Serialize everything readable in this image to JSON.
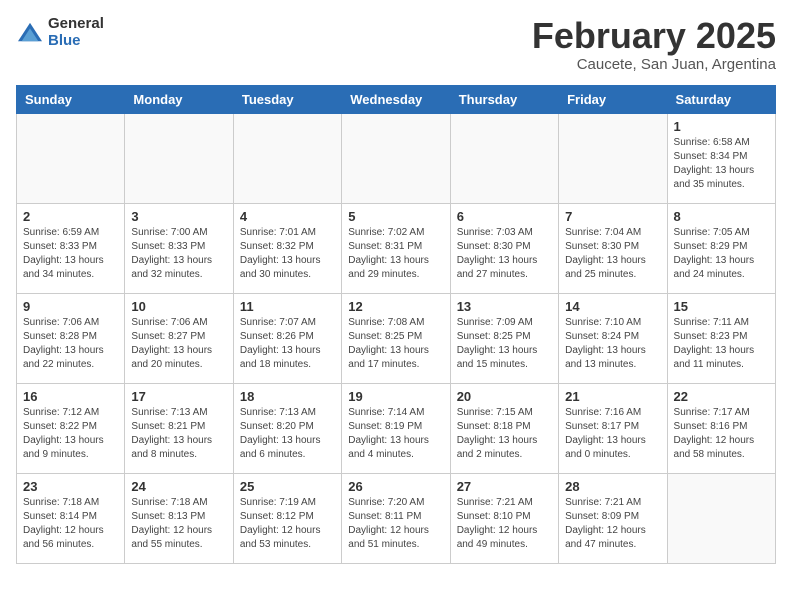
{
  "logo": {
    "general": "General",
    "blue": "Blue"
  },
  "title": "February 2025",
  "subtitle": "Caucete, San Juan, Argentina",
  "days_of_week": [
    "Sunday",
    "Monday",
    "Tuesday",
    "Wednesday",
    "Thursday",
    "Friday",
    "Saturday"
  ],
  "weeks": [
    [
      {
        "day": "",
        "info": ""
      },
      {
        "day": "",
        "info": ""
      },
      {
        "day": "",
        "info": ""
      },
      {
        "day": "",
        "info": ""
      },
      {
        "day": "",
        "info": ""
      },
      {
        "day": "",
        "info": ""
      },
      {
        "day": "1",
        "info": "Sunrise: 6:58 AM\nSunset: 8:34 PM\nDaylight: 13 hours and 35 minutes."
      }
    ],
    [
      {
        "day": "2",
        "info": "Sunrise: 6:59 AM\nSunset: 8:33 PM\nDaylight: 13 hours and 34 minutes."
      },
      {
        "day": "3",
        "info": "Sunrise: 7:00 AM\nSunset: 8:33 PM\nDaylight: 13 hours and 32 minutes."
      },
      {
        "day": "4",
        "info": "Sunrise: 7:01 AM\nSunset: 8:32 PM\nDaylight: 13 hours and 30 minutes."
      },
      {
        "day": "5",
        "info": "Sunrise: 7:02 AM\nSunset: 8:31 PM\nDaylight: 13 hours and 29 minutes."
      },
      {
        "day": "6",
        "info": "Sunrise: 7:03 AM\nSunset: 8:30 PM\nDaylight: 13 hours and 27 minutes."
      },
      {
        "day": "7",
        "info": "Sunrise: 7:04 AM\nSunset: 8:30 PM\nDaylight: 13 hours and 25 minutes."
      },
      {
        "day": "8",
        "info": "Sunrise: 7:05 AM\nSunset: 8:29 PM\nDaylight: 13 hours and 24 minutes."
      }
    ],
    [
      {
        "day": "9",
        "info": "Sunrise: 7:06 AM\nSunset: 8:28 PM\nDaylight: 13 hours and 22 minutes."
      },
      {
        "day": "10",
        "info": "Sunrise: 7:06 AM\nSunset: 8:27 PM\nDaylight: 13 hours and 20 minutes."
      },
      {
        "day": "11",
        "info": "Sunrise: 7:07 AM\nSunset: 8:26 PM\nDaylight: 13 hours and 18 minutes."
      },
      {
        "day": "12",
        "info": "Sunrise: 7:08 AM\nSunset: 8:25 PM\nDaylight: 13 hours and 17 minutes."
      },
      {
        "day": "13",
        "info": "Sunrise: 7:09 AM\nSunset: 8:25 PM\nDaylight: 13 hours and 15 minutes."
      },
      {
        "day": "14",
        "info": "Sunrise: 7:10 AM\nSunset: 8:24 PM\nDaylight: 13 hours and 13 minutes."
      },
      {
        "day": "15",
        "info": "Sunrise: 7:11 AM\nSunset: 8:23 PM\nDaylight: 13 hours and 11 minutes."
      }
    ],
    [
      {
        "day": "16",
        "info": "Sunrise: 7:12 AM\nSunset: 8:22 PM\nDaylight: 13 hours and 9 minutes."
      },
      {
        "day": "17",
        "info": "Sunrise: 7:13 AM\nSunset: 8:21 PM\nDaylight: 13 hours and 8 minutes."
      },
      {
        "day": "18",
        "info": "Sunrise: 7:13 AM\nSunset: 8:20 PM\nDaylight: 13 hours and 6 minutes."
      },
      {
        "day": "19",
        "info": "Sunrise: 7:14 AM\nSunset: 8:19 PM\nDaylight: 13 hours and 4 minutes."
      },
      {
        "day": "20",
        "info": "Sunrise: 7:15 AM\nSunset: 8:18 PM\nDaylight: 13 hours and 2 minutes."
      },
      {
        "day": "21",
        "info": "Sunrise: 7:16 AM\nSunset: 8:17 PM\nDaylight: 13 hours and 0 minutes."
      },
      {
        "day": "22",
        "info": "Sunrise: 7:17 AM\nSunset: 8:16 PM\nDaylight: 12 hours and 58 minutes."
      }
    ],
    [
      {
        "day": "23",
        "info": "Sunrise: 7:18 AM\nSunset: 8:14 PM\nDaylight: 12 hours and 56 minutes."
      },
      {
        "day": "24",
        "info": "Sunrise: 7:18 AM\nSunset: 8:13 PM\nDaylight: 12 hours and 55 minutes."
      },
      {
        "day": "25",
        "info": "Sunrise: 7:19 AM\nSunset: 8:12 PM\nDaylight: 12 hours and 53 minutes."
      },
      {
        "day": "26",
        "info": "Sunrise: 7:20 AM\nSunset: 8:11 PM\nDaylight: 12 hours and 51 minutes."
      },
      {
        "day": "27",
        "info": "Sunrise: 7:21 AM\nSunset: 8:10 PM\nDaylight: 12 hours and 49 minutes."
      },
      {
        "day": "28",
        "info": "Sunrise: 7:21 AM\nSunset: 8:09 PM\nDaylight: 12 hours and 47 minutes."
      },
      {
        "day": "",
        "info": ""
      }
    ]
  ]
}
